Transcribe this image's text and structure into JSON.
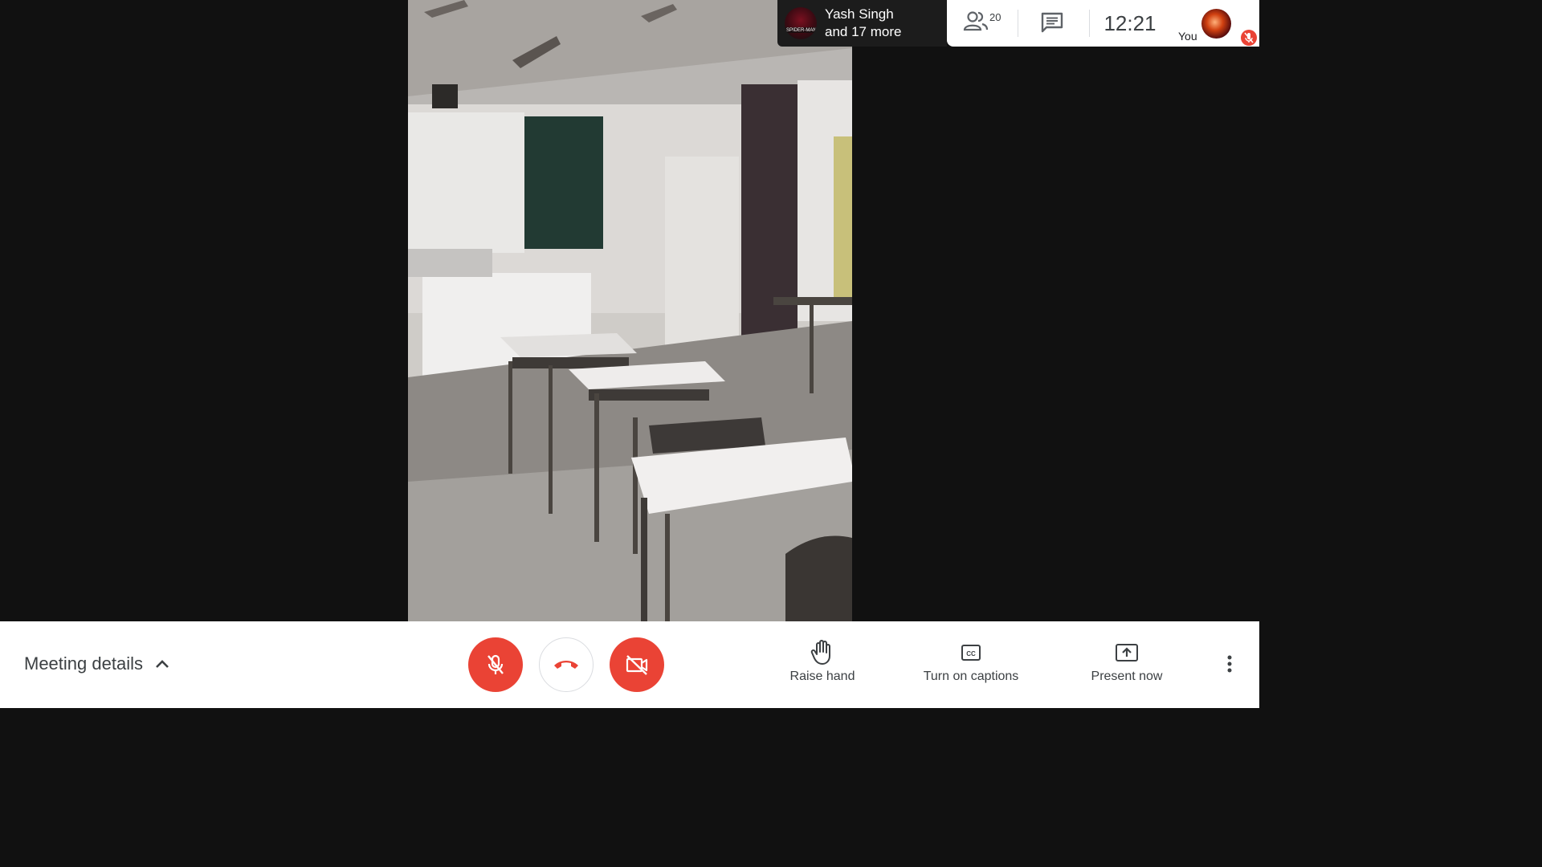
{
  "speaker": {
    "name": "Yash Singh",
    "more": "and 17 more",
    "avatar_text": "SPIDER-MAN"
  },
  "top_panel": {
    "people_count": "20",
    "people_icon": "people-icon",
    "chat_icon": "chat-icon",
    "time": "12:21"
  },
  "self_tile": {
    "label": "You",
    "muted_icon": "mic-off-icon"
  },
  "bottom_bar": {
    "meeting_details_label": "Meeting details",
    "meeting_details_icon": "chevron-up-icon",
    "mic_button_icon": "mic-off-icon",
    "hangup_icon": "call-end-icon",
    "camera_button_icon": "videocam-off-icon",
    "raise_hand_label": "Raise hand",
    "captions_label": "Turn on captions",
    "present_label": "Present now",
    "more_icon": "more-vert-icon"
  },
  "colors": {
    "background": "#111111",
    "danger_red": "#ea4335",
    "bar_white": "#ffffff",
    "text_gray": "#3c4043"
  }
}
